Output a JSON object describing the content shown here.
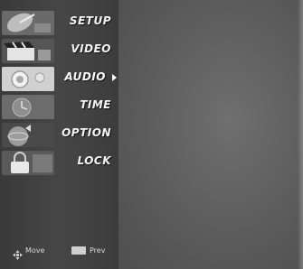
{
  "menu": {
    "items": [
      {
        "label": "SETUP",
        "icon": "satellite-dish-icon"
      },
      {
        "label": "VIDEO",
        "icon": "film-clapper-icon"
      },
      {
        "label": "AUDIO",
        "icon": "speaker-icon"
      },
      {
        "label": "TIME",
        "icon": "clock-icon"
      },
      {
        "label": "OPTION",
        "icon": "option-globe-icon"
      },
      {
        "label": "LOCK",
        "icon": "padlock-icon"
      }
    ],
    "selected_item": "AUDIO"
  },
  "footer": {
    "move_label": "Move",
    "prev_label": "Prev",
    "move_icon": "four-way-arrows-icon",
    "menu_key_icon": "menu-key-icon"
  },
  "colors": {
    "panel": "#3f3f3f",
    "background": "#5f5f5f",
    "label": "#f4f4f4",
    "selected_thumb": "#d8d8d8"
  }
}
